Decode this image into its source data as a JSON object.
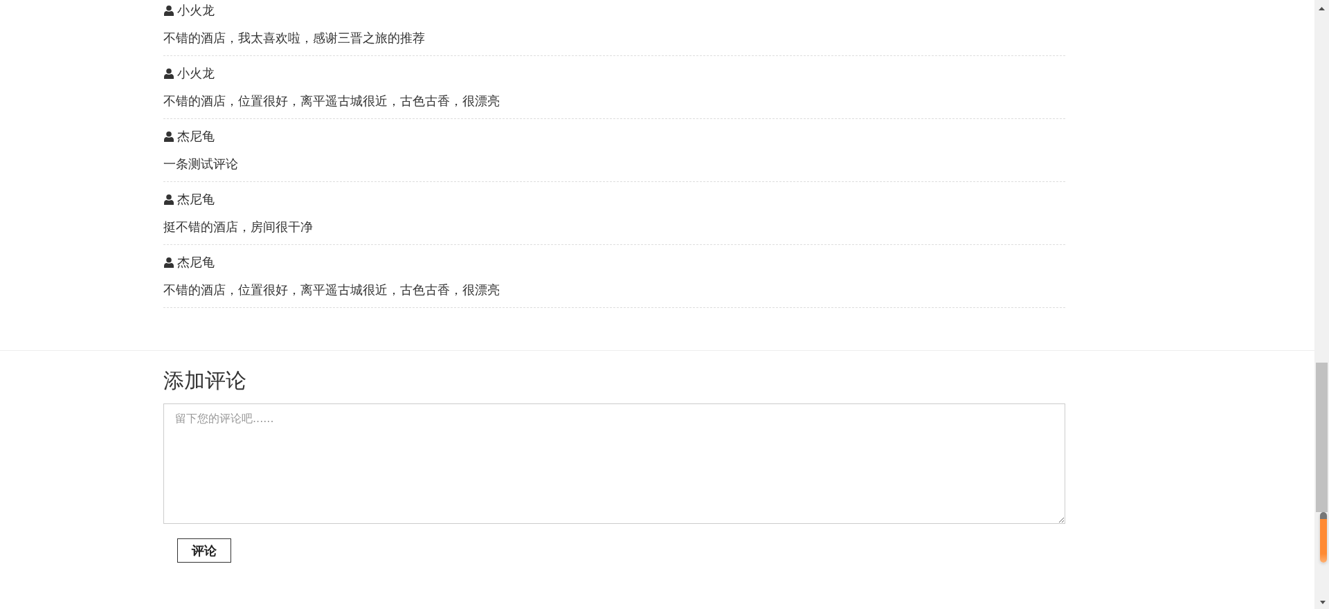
{
  "comments": [
    {
      "user": "小火龙",
      "text": "不错的酒店，我太喜欢啦，感谢三晋之旅的推荐"
    },
    {
      "user": "小火龙",
      "text": "不错的酒店，位置很好，离平遥古城很近，古色古香，很漂亮"
    },
    {
      "user": "杰尼龟",
      "text": "一条测试评论"
    },
    {
      "user": "杰尼龟",
      "text": "挺不错的酒店，房间很干净"
    },
    {
      "user": "杰尼龟",
      "text": "不错的酒店，位置很好，离平遥古城很近，古色古香，很漂亮"
    }
  ],
  "add_comment": {
    "title": "添加评论",
    "placeholder": "留下您的评论吧......",
    "button": "评论"
  }
}
